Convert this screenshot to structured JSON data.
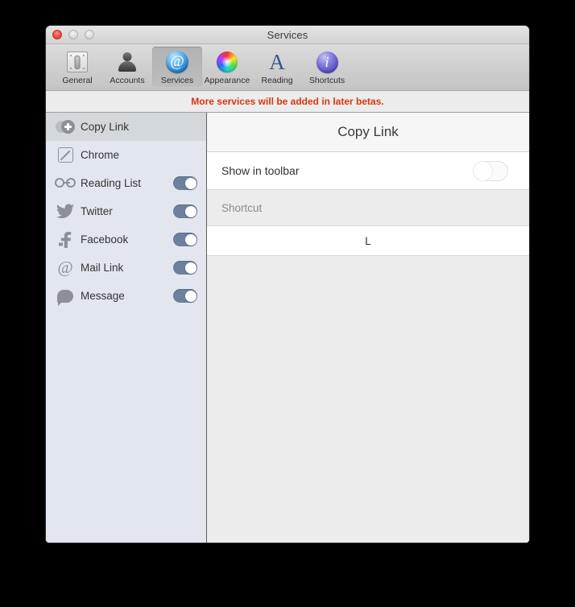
{
  "window": {
    "title": "Services",
    "traffic_lights": [
      "close-button",
      "minimize-button",
      "zoom-button"
    ]
  },
  "toolbar": {
    "items": [
      {
        "label": "General",
        "icon": "switch-plate-icon",
        "selected": false
      },
      {
        "label": "Accounts",
        "icon": "person-icon",
        "selected": false
      },
      {
        "label": "Services",
        "icon": "at-sign-icon",
        "selected": true
      },
      {
        "label": "Appearance",
        "icon": "color-wheel-icon",
        "selected": false
      },
      {
        "label": "Reading",
        "icon": "letter-a-icon",
        "selected": false
      },
      {
        "label": "Shortcuts",
        "icon": "info-icon",
        "selected": false
      }
    ]
  },
  "notice": {
    "text": "More services will be added in later betas.",
    "color": "#d8360f"
  },
  "sidebar": {
    "items": [
      {
        "label": "Copy Link",
        "icon": "copy-link-icon",
        "selected": true,
        "toggle": null
      },
      {
        "label": "Chrome",
        "icon": "chrome-icon",
        "selected": false,
        "toggle": null
      },
      {
        "label": "Reading List",
        "icon": "glasses-icon",
        "selected": false,
        "toggle": "on"
      },
      {
        "label": "Twitter",
        "icon": "twitter-bird-icon",
        "selected": false,
        "toggle": "on"
      },
      {
        "label": "Facebook",
        "icon": "facebook-f-icon",
        "selected": false,
        "toggle": "on"
      },
      {
        "label": "Mail Link",
        "icon": "at-sign-icon",
        "selected": false,
        "toggle": "on"
      },
      {
        "label": "Message",
        "icon": "speech-bubble-icon",
        "selected": false,
        "toggle": "on"
      }
    ]
  },
  "detail": {
    "title": "Copy Link",
    "show_in_toolbar": {
      "label": "Show in toolbar",
      "state": "off"
    },
    "shortcut": {
      "header": "Shortcut",
      "value": "L"
    }
  },
  "colors": {
    "toggle_on": "#6d819e",
    "sidebar_bg": "#e2e7ef",
    "selected_row": "#d3d8dc",
    "notice_text": "#d8360f"
  }
}
